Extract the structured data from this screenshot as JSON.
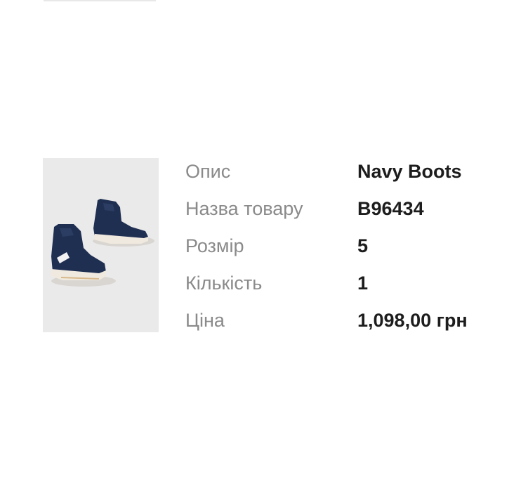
{
  "product": {
    "image_icon": "navy-boots-photo",
    "details": [
      {
        "label": "Опис",
        "value": "Navy Boots"
      },
      {
        "label": "Назва товару",
        "value": "B96434"
      },
      {
        "label": "Розмір",
        "value": "5"
      },
      {
        "label": "Кількість",
        "value": "1"
      },
      {
        "label": "Ціна",
        "value": "1,098,00 грн"
      }
    ]
  },
  "colors": {
    "label": "#8a8a8a",
    "value": "#1d1d1d",
    "image_bg": "#ebeaea",
    "boot_navy": "#1f2f52"
  }
}
